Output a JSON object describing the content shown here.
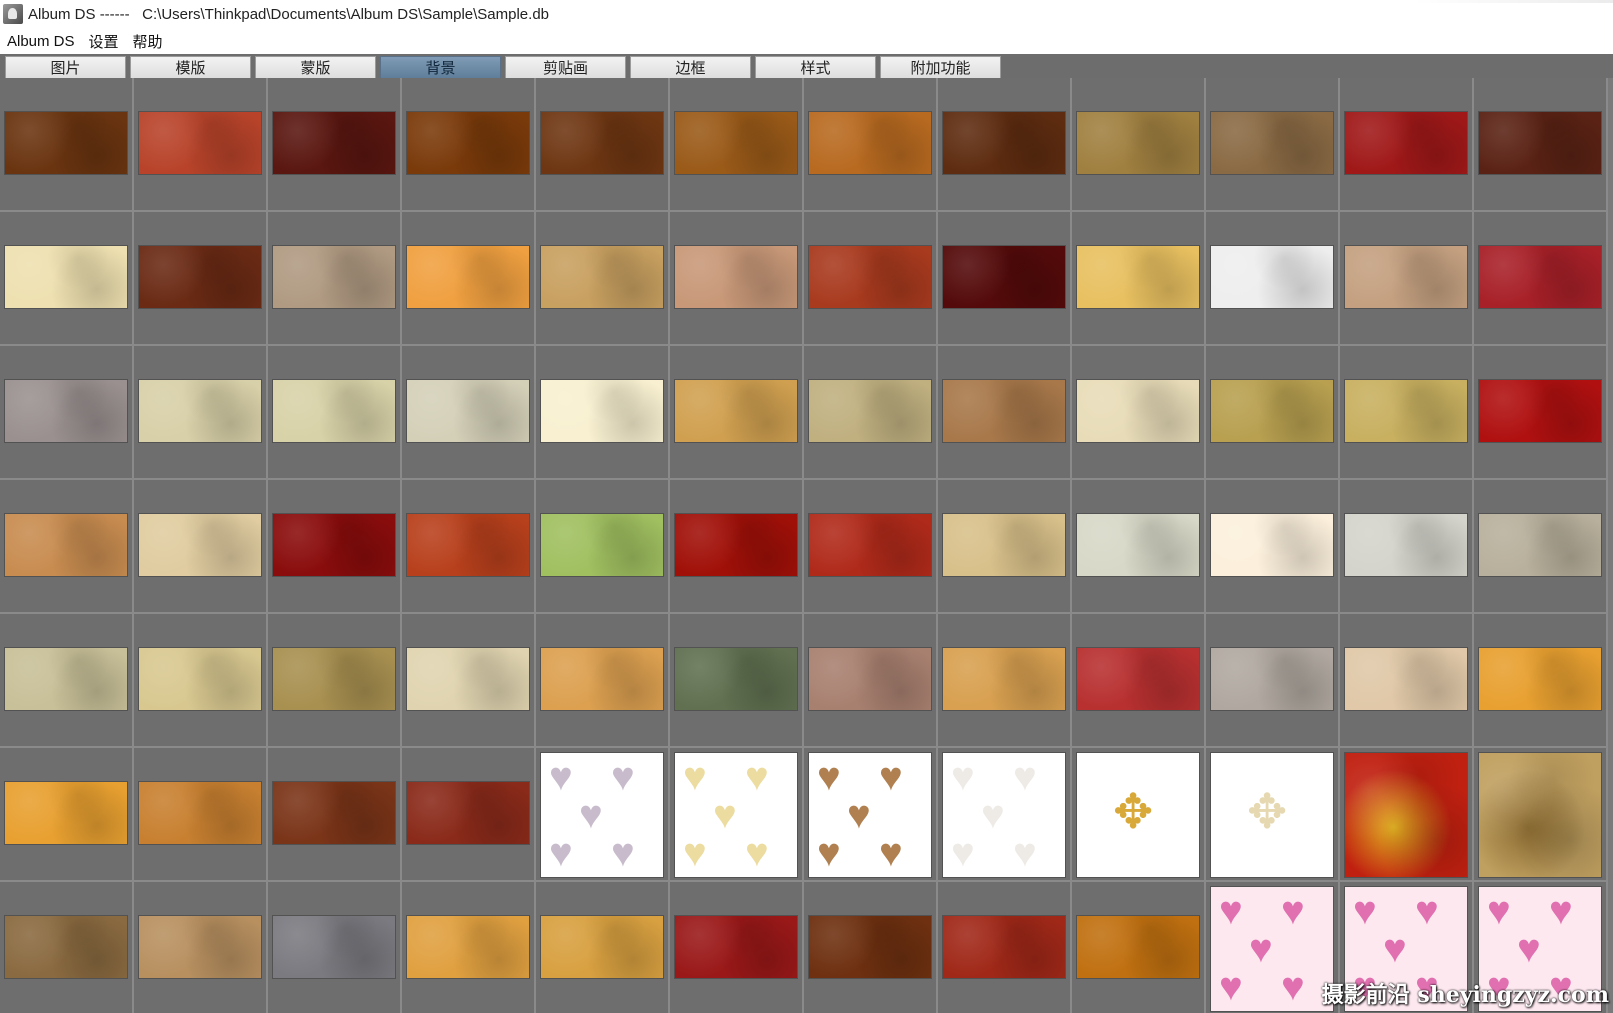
{
  "window": {
    "title": "Album DS ------   C:\\Users\\Thinkpad\\Documents\\Album DS\\Sample\\Sample.db",
    "icon": "album-ds-app-icon"
  },
  "menu": [
    "Album DS",
    "设置",
    "帮助"
  ],
  "tabs": [
    {
      "label": "图片",
      "active": false
    },
    {
      "label": "模版",
      "active": false
    },
    {
      "label": "蒙版",
      "active": false
    },
    {
      "label": "背景",
      "active": true
    },
    {
      "label": "剪贴画",
      "active": false
    },
    {
      "label": "边框",
      "active": false
    },
    {
      "label": "样式",
      "active": false
    },
    {
      "label": "附加功能",
      "active": false
    }
  ],
  "watermark": "摄影前沿 sheyingzyz.com",
  "thumbnails": [
    [
      "#6a3410",
      "#b8432a",
      "#5a1610",
      "#7a3a0a",
      "#6e3612",
      "#9a5a18",
      "#b86a20",
      "#5e2c10",
      "#a08040",
      "#8a6a44",
      "#a01818",
      "#5a2214"
    ],
    [
      "#eee0b0",
      "#6a2a14",
      "#b09a82",
      "#f0a040",
      "#c8a060",
      "#c89878",
      "#a83a1e",
      "#540a0a",
      "#e8c060",
      "#eeeeee",
      "#c4a080",
      "#a82028"
    ],
    [
      "#9a9090",
      "#d8d0a8",
      "#d8d2a8",
      "#d4d0b8",
      "#f8f0d0",
      "#d0a050",
      "#c0b080",
      "#a8784a",
      "#e8dcb8",
      "#b8a050",
      "#c8b060",
      "#b01010"
    ],
    [
      "#c88c50",
      "#e0cca0",
      "#8a0c0c",
      "#b8401c",
      "#a0c060",
      "#a01008",
      "#b02a1a",
      "#d8c08a",
      "#d8d8c8",
      "#fcf0dc",
      "#d4d4cc",
      "#b8b09c"
    ],
    [
      "#c8c098",
      "#d8c890",
      "#a89050",
      "#e0d4b0",
      "#dca050",
      "#607050",
      "#a88070",
      "#d8a050",
      "#b83030",
      "#b0a8a0",
      "#e0c8a8",
      "#e8a030"
    ],
    [
      "#e8a030",
      "#c88030",
      "#7a3418",
      "#8a2a1a",
      {
        "pattern": "hearts",
        "bg": "#ffffff",
        "fg": "#c8bccc"
      },
      {
        "pattern": "hearts",
        "bg": "#ffffff",
        "fg": "#ecdca0"
      },
      {
        "pattern": "hearts",
        "bg": "#ffffff",
        "fg": "#b08050"
      },
      {
        "pattern": "hearts",
        "bg": "#ffffff",
        "fg": "#eeeae6"
      },
      {
        "pattern": "ornament",
        "bg": "#ffffff",
        "fg": "#d8a838"
      },
      {
        "pattern": "ornament",
        "bg": "#ffffff",
        "fg": "#e6d8b0"
      },
      {
        "pattern": "grunge",
        "bg": "#c02010",
        "fg": "#e0b020"
      },
      {
        "pattern": "grunge",
        "bg": "#c0a060",
        "fg": "#8a6a30"
      }
    ],
    [
      "#8a6a40",
      "#b89060",
      "#7a7a80",
      "#e0a040",
      "#d8a040",
      "#9a1818",
      "#6e3010",
      "#a02818",
      "#c07010",
      {
        "pattern": "hearts",
        "bg": "#fde8f0",
        "fg": "#e070b0"
      },
      {
        "pattern": "cherub",
        "bg": "#fde8f0",
        "fg": "#e070b0"
      },
      {
        "pattern": "bells",
        "bg": "#fde8f0",
        "fg": "#e070b0"
      }
    ]
  ]
}
